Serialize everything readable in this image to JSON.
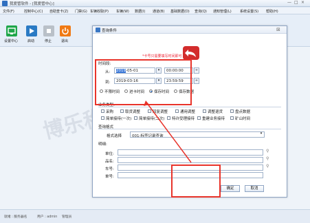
{
  "window": {
    "title": "我爱管软件 - [我爱管中心]",
    "controls": [
      "—",
      "□",
      "×"
    ]
  },
  "menu": [
    "文件(F)",
    "控制中心(C)",
    "自助查卡(Z)",
    "门禁(G)",
    "车辆收取(P)",
    "车辆(W)",
    "数据(I)",
    "通道(B)",
    "基础数据(D)",
    "查询(Q)",
    "通知管理(L)",
    "系统设置(S)",
    "帮助(H)"
  ],
  "toolbar": {
    "buttons": [
      {
        "label": "设置中心",
        "color": "#1fa64a"
      },
      {
        "label": "启动",
        "color": "#2a7ac4"
      },
      {
        "label": "停止",
        "color": "#b9c0c8"
      },
      {
        "label": "退出",
        "color": "#f07a14"
      }
    ]
  },
  "dialog": {
    "title": "查询条件",
    "warning": "*卡号只需要填写时间即可",
    "time_section": "时间段:",
    "from_label": "从:",
    "from_date_highlight": "2019",
    "from_date_rest": "-05-01",
    "from_time": "00:00:00",
    "to_label": "到:",
    "to_date": "2019-03-16",
    "to_time": "23:59:59",
    "time_options": [
      {
        "label": "不限时间",
        "selected": false
      },
      {
        "label": "进卡时间",
        "selected": false
      },
      {
        "label": "保存时间",
        "selected": true
      },
      {
        "label": "保存数据",
        "selected": false
      }
    ],
    "biz_section": "业务类型:",
    "biz_row1": [
      "采购",
      "取货调整",
      "回复调整",
      "通用调整",
      "调整退货",
      "盘点数据"
    ],
    "biz_row2": [
      "简单接待(一次)",
      "简单接待(二次)",
      "特许受理接待",
      "重建业务接待",
      "矿山时间"
    ],
    "query_section": "查询格式",
    "format_label": "格式选择",
    "format_value": "001-标签记录查询",
    "detail_section": "明细:",
    "fields": [
      {
        "label": "单位:",
        "value": ""
      },
      {
        "label": "品名:",
        "value": ""
      },
      {
        "label": "车号:",
        "value": ""
      },
      {
        "label": "单号:",
        "value": ""
      }
    ],
    "ok_label": "确定",
    "cancel_label": "取消",
    "dropdown_arrow": "▾",
    "spin_glyph": "÷",
    "close_glyph": "⊠"
  },
  "statusbar": {
    "items": [
      "就绪 : 服务器名",
      "用户 : admin",
      "管理员"
    ]
  },
  "watermark": "博乐称重软件",
  "accent_red": "#e8332a"
}
